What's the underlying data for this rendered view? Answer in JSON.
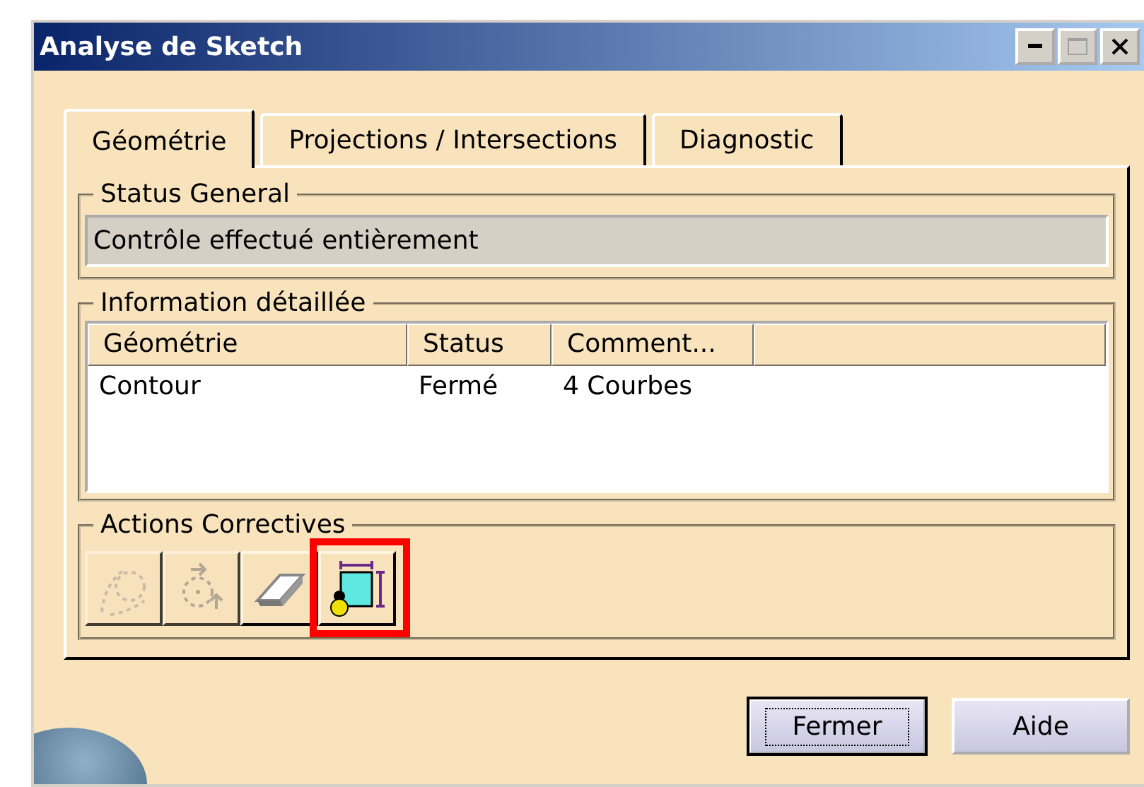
{
  "window": {
    "title": "Analyse de Sketch"
  },
  "tabs": [
    {
      "label": "Géométrie",
      "selected": true
    },
    {
      "label": "Projections / Intersections",
      "selected": false
    },
    {
      "label": "Diagnostic",
      "selected": false
    }
  ],
  "status_general": {
    "label": "Status General",
    "value": "Contrôle effectué entièrement"
  },
  "detailed_info": {
    "label": "Information détaillée",
    "columns": [
      "Géométrie",
      "Status",
      "Comment..."
    ],
    "rows": [
      [
        "Contour",
        "Fermé",
        "4 Courbes"
      ]
    ]
  },
  "corrective_actions": {
    "label": "Actions Correctives",
    "buttons": [
      {
        "kind": "close-gap",
        "disabled": true,
        "highlighted": false
      },
      {
        "kind": "relimit",
        "disabled": true,
        "highlighted": false
      },
      {
        "kind": "erase",
        "disabled": false,
        "highlighted": false
      },
      {
        "kind": "constrain",
        "disabled": false,
        "highlighted": true
      }
    ]
  },
  "buttons": [
    {
      "label": "Fermer",
      "default": true
    },
    {
      "label": "Aide",
      "default": false
    }
  ]
}
